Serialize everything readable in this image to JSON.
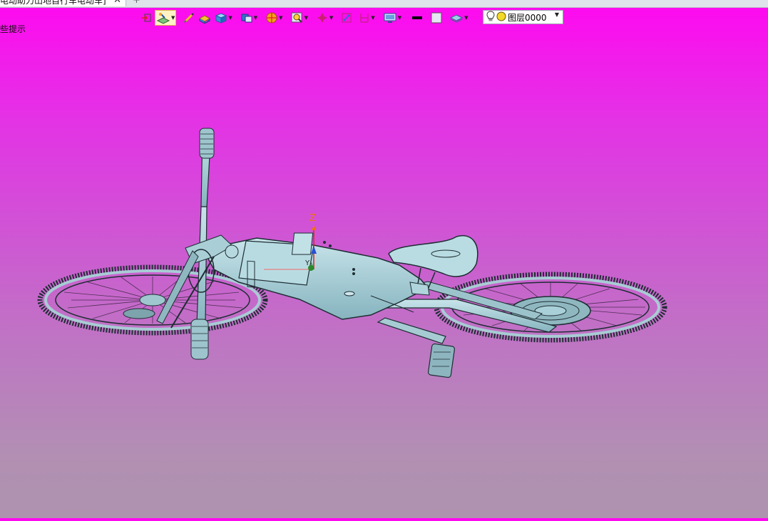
{
  "tabs": {
    "active_label": "电动助力山地自行车电动车]",
    "close_glyph": "✕",
    "new_tab_glyph": "+"
  },
  "hint": {
    "text": "些提示"
  },
  "layer": {
    "value": "图层0000"
  },
  "toolbar": {
    "icons": [
      "exit-sketch-icon",
      "sketch-plane-icon",
      "pen-icon",
      "extrude-icon",
      "box-solid-icon",
      "view-direction-icon",
      "render-style-icon",
      "zoom-icon",
      "snap-point-icon",
      "fit-view-icon",
      "dimension-icon",
      "display-settings-icon",
      "line-color-icon",
      "fill-color-icon",
      "layer-icon"
    ]
  },
  "triad": {
    "z_label": "Z",
    "y_label": "Y"
  },
  "colors": {
    "bg_top": "#ff08f0",
    "bg_bottom": "#ad93ae",
    "model_fill": "#aacfd6",
    "model_edge": "#1e2d33",
    "spoke": "#4a2d4a"
  }
}
